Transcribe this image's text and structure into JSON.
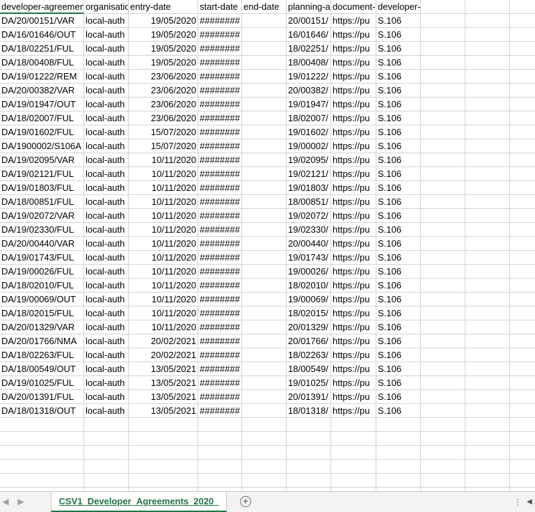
{
  "headers": [
    "developer-agreement",
    "organisation",
    "entry-date",
    "start-date",
    "end-date",
    "planning-application",
    "document-url",
    "developer-agreement-classification"
  ],
  "rows": [
    [
      "DA/20/00151/VAR",
      "local-auth",
      "19/05/2020",
      "########",
      "",
      "20/00151/",
      "https://pu",
      "S.106"
    ],
    [
      "DA/16/01646/OUT",
      "local-auth",
      "19/05/2020",
      "########",
      "",
      "16/01646/",
      "https://pu",
      "S.106"
    ],
    [
      "DA/18/02251/FUL",
      "local-auth",
      "19/05/2020",
      "########",
      "",
      "18/02251/",
      "https://pu",
      "S.106"
    ],
    [
      "DA/18/00408/FUL",
      "local-auth",
      "19/05/2020",
      "########",
      "",
      "18/00408/",
      "https://pu",
      "S.106"
    ],
    [
      "DA/19/01222/REM",
      "local-auth",
      "23/06/2020",
      "########",
      "",
      "19/01222/",
      "https://pu",
      "S.106"
    ],
    [
      "DA/20/00382/VAR",
      "local-auth",
      "23/06/2020",
      "########",
      "",
      "20/00382/",
      "https://pu",
      "S.106"
    ],
    [
      "DA/19/01947/OUT",
      "local-auth",
      "23/06/2020",
      "########",
      "",
      "19/01947/",
      "https://pu",
      "S.106"
    ],
    [
      "DA/18/02007/FUL",
      "local-auth",
      "23/06/2020",
      "########",
      "",
      "18/02007/",
      "https://pu",
      "S.106"
    ],
    [
      "DA/19/01602/FUL",
      "local-auth",
      "15/07/2020",
      "########",
      "",
      "19/01602/",
      "https://pu",
      "S.106"
    ],
    [
      "DA/1900002/S106A",
      "local-auth",
      "15/07/2020",
      "########",
      "",
      "19/00002/",
      "https://pu",
      "S.106"
    ],
    [
      "DA/19/02095/VAR",
      "local-auth",
      "10/11/2020",
      "########",
      "",
      "19/02095/",
      "https://pu",
      "S.106"
    ],
    [
      "DA/19/02121/FUL",
      "local-auth",
      "10/11/2020",
      "########",
      "",
      "19/02121/",
      "https://pu",
      "S.106"
    ],
    [
      "DA/19/01803/FUL",
      "local-auth",
      "10/11/2020",
      "########",
      "",
      "19/01803/",
      "https://pu",
      "S.106"
    ],
    [
      "DA/18/00851/FUL",
      "local-auth",
      "10/11/2020",
      "########",
      "",
      "18/00851/",
      "https://pu",
      "S.106"
    ],
    [
      "DA/19/02072/VAR",
      "local-auth",
      "10/11/2020",
      "########",
      "",
      "19/02072/",
      "https://pu",
      "S.106"
    ],
    [
      "DA/19/02330/FUL",
      "local-auth",
      "10/11/2020",
      "########",
      "",
      "19/02330/",
      "https://pu",
      "S.106"
    ],
    [
      "DA/20/00440/VAR",
      "local-auth",
      "10/11/2020",
      "########",
      "",
      "20/00440/",
      "https://pu",
      "S.106"
    ],
    [
      "DA/19/01743/FUL",
      "local-auth",
      "10/11/2020",
      "########",
      "",
      "19/01743/",
      "https://pu",
      "S.106"
    ],
    [
      "DA/19/00026/FUL",
      "local-auth",
      "10/11/2020",
      "########",
      "",
      "19/00026/",
      "https://pu",
      "S.106"
    ],
    [
      "DA/18/02010/FUL",
      "local-auth",
      "10/11/2020",
      "########",
      "",
      "18/02010/",
      "https://pu",
      "S.106"
    ],
    [
      "DA/19/00069/OUT",
      "local-auth",
      "10/11/2020",
      "########",
      "",
      "19/00069/",
      "https://pu",
      "S.106"
    ],
    [
      "DA/18/02015/FUL",
      "local-auth",
      "10/11/2020",
      "########",
      "",
      "18/02015/",
      "https://pu",
      "S.106"
    ],
    [
      "DA/20/01329/VAR",
      "local-auth",
      "10/11/2020",
      "########",
      "",
      "20/01329/",
      "https://pu",
      "S.106"
    ],
    [
      "DA/20/01766/NMA",
      "local-auth",
      "20/02/2021",
      "########",
      "",
      "20/01766/",
      "https://pu",
      "S.106"
    ],
    [
      "DA/18/02263/FUL",
      "local-auth",
      "20/02/2021",
      "########",
      "",
      "18/02263/",
      "https://pu",
      "S.106"
    ],
    [
      "DA/18/00549/OUT",
      "local-auth",
      "13/05/2021",
      "########",
      "",
      "18/00549/",
      "https://pu",
      "S.106"
    ],
    [
      "DA/19/01025/FUL",
      "local-auth",
      "13/05/2021",
      "########",
      "",
      "19/01025/",
      "https://pu",
      "S.106"
    ],
    [
      "DA/20/01391/FUL",
      "local-auth",
      "13/05/2021",
      "########",
      "",
      "20/01391/",
      "https://pu",
      "S.106"
    ],
    [
      "DA/18/01318/OUT",
      "local-auth",
      "13/05/2021",
      "########",
      "",
      "18/01318/",
      "https://pu",
      "S.106"
    ]
  ],
  "sheet_tab": {
    "label": "CSV1_Developer_Agreements_2020_"
  },
  "icons": {
    "nav_prev": "chevron-left-icon",
    "nav_next": "chevron-right-icon",
    "add_sheet": "plus-circle-icon",
    "splitter": "vertical-dots-icon"
  },
  "colors": {
    "accent": "#217346",
    "gridline": "#d4d4d4",
    "tabbar_bg": "#f3f3f3"
  }
}
